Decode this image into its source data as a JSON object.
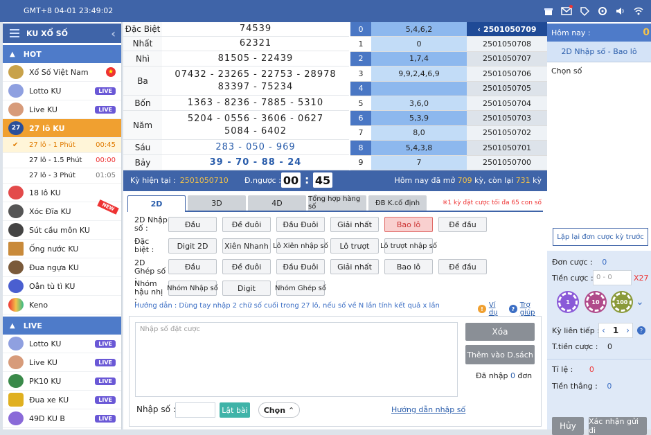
{
  "topbar": {
    "time": "GMT+8 04-01 23:49:02"
  },
  "sidebar": {
    "title": "KU XỔ SỐ",
    "hot": "HOT",
    "hot_items": [
      {
        "label": "Xổ Số Việt Nam",
        "icon": "vn-flag-icon"
      },
      {
        "label": "Lotto KU",
        "badge": "LIVE"
      },
      {
        "label": "Live KU",
        "badge": "LIVE"
      },
      {
        "label": "27 lô KU"
      }
    ],
    "subs": [
      {
        "label": "27 lô - 1 Phút",
        "time": "00:45"
      },
      {
        "label": "27 lô - 1.5 Phút",
        "time": "00:00"
      },
      {
        "label": "27 lô - 3 Phút",
        "time": "01:05"
      }
    ],
    "more": [
      {
        "label": "18 lô KU"
      },
      {
        "label": "Xóc Đĩa KU",
        "tag": "NEW"
      },
      {
        "label": "Sút cầu môn KU"
      },
      {
        "label": "Ống nước KU"
      },
      {
        "label": "Đua ngựa KU"
      },
      {
        "label": "Oẳn tù tì KU"
      },
      {
        "label": "Keno"
      }
    ],
    "live": "LIVE",
    "live_items": [
      {
        "label": "Lotto KU",
        "badge": "LIVE"
      },
      {
        "label": "Live KU",
        "badge": "LIVE"
      },
      {
        "label": "PK10 KU",
        "badge": "LIVE"
      },
      {
        "label": "Đua xe KU",
        "badge": "LIVE"
      },
      {
        "label": "49D KU B",
        "badge": "LIVE"
      }
    ]
  },
  "results": [
    {
      "label": "Đặc Biệt",
      "lines": [
        "74539"
      ]
    },
    {
      "label": "Nhất",
      "lines": [
        "62321"
      ]
    },
    {
      "label": "Nhì",
      "lines": [
        "81505 - 22439"
      ]
    },
    {
      "label": "Ba",
      "lines": [
        "07432 - 23265 - 22753 - 28978",
        "83397 - 75234"
      ]
    },
    {
      "label": "Bốn",
      "lines": [
        "1363 - 8236 - 7885 - 5310"
      ]
    },
    {
      "label": "Năm",
      "lines": [
        "5204 - 0556 - 3606 - 0627",
        "5084 - 6402"
      ]
    },
    {
      "label": "Sáu",
      "lines": [
        "283 - 050 - 969"
      ]
    },
    {
      "label": "Bảy",
      "lines": [
        "39 - 70 - 88 - 24"
      ]
    }
  ],
  "loto": [
    {
      "d": "0",
      "t": "5,4,6,2",
      "p": "2501050709"
    },
    {
      "d": "1",
      "t": "0",
      "p": "2501050708"
    },
    {
      "d": "2",
      "t": "1,7,4",
      "p": "2501050707"
    },
    {
      "d": "3",
      "t": "9,9,2,4,6,9",
      "p": "2501050706"
    },
    {
      "d": "4",
      "t": "",
      "p": "2501050705"
    },
    {
      "d": "5",
      "t": "3,6,0",
      "p": "2501050704"
    },
    {
      "d": "6",
      "t": "5,3,9",
      "p": "2501050703"
    },
    {
      "d": "7",
      "t": "8,0",
      "p": "2501050702"
    },
    {
      "d": "8",
      "t": "5,4,3,8",
      "p": "2501050701"
    },
    {
      "d": "9",
      "t": "7",
      "p": "2501050700"
    }
  ],
  "info": {
    "ky_label": "Kỳ hiện tại :",
    "ky": "2501050710",
    "dn_label": "Đ.ngược :",
    "min": "00",
    "sec": "45",
    "today_a": "Hôm nay đã mở ",
    "open": "709",
    "today_b": " kỳ, còn lại ",
    "left": "731",
    "today_c": " kỳ"
  },
  "tabs": [
    "2D",
    "3D",
    "4D",
    "Tổng hợp hàng số",
    "ĐB K.cố định"
  ],
  "tab_note": "※1 kỳ đặt cược tối đa 65 con số",
  "groups": [
    {
      "label": "2D Nhập số :",
      "buttons": [
        "Đầu",
        "Đề đuôi",
        "Đầu Đuôi",
        "Giải nhất",
        "Bao lô",
        "Đề đầu"
      ]
    },
    {
      "label": "Đặc biệt :",
      "buttons": [
        "Digit 2D",
        "Xiên Nhanh",
        "Lô Xiên nhập số",
        "Lô trượt",
        "Lô trượt nhập số"
      ]
    },
    {
      "label": "2D Ghép số :",
      "buttons": [
        "Đầu",
        "Đề đuôi",
        "Đầu Đuôi",
        "Giải nhất",
        "Bao lô",
        "Đề đầu"
      ]
    },
    {
      "label": "Nhóm hậu nhị :",
      "buttons": [
        "Nhóm Nhập số",
        "Digit",
        "Nhóm Ghép số"
      ]
    }
  ],
  "guide": "Hướng dẫn : Dùng tay nhập 2 chữ số cuối trong 27 lô, nếu số về N lần tính kết quả x lần",
  "vidu": "Ví dụ",
  "trogiup": "Trợ giúp",
  "entry": {
    "placeholder": "Nhập số đặt cược",
    "xoa": "Xóa",
    "them": "Thêm vào D.sách",
    "danhap_a": "Đã nhập ",
    "danhap_n": "0",
    "danhap_b": " đơn",
    "np": "Nhập số :",
    "latbai": "Lật bài",
    "chon": "Chọn",
    "hd": "Hướng dẫn nhập số"
  },
  "right": {
    "homnay": "Hôm nay :",
    "homnay_val": "0",
    "mode": "2D Nhập số - Bao lô",
    "chonso": "Chọn số",
    "laplai": "Lặp lại đơn cược kỳ trước",
    "doncuoc": "Đơn cược :",
    "doncuoc_v": "0",
    "tiencuoc": "Tiền cược :",
    "tien_ph": "0 - 0",
    "mult": "X27",
    "chips": [
      "1",
      "10",
      "100"
    ],
    "kylt": "Kỳ liên tiếp :",
    "kylt_v": "1",
    "ttc": "T.tiền cược :",
    "ttc_v": "0",
    "tile": "Tỉ lệ :",
    "tile_v": "0",
    "tienthang": "Tiền thắng :",
    "tienthang_v": "0",
    "huy": "Hủy",
    "xn": "Xác nhận gửi đi"
  }
}
